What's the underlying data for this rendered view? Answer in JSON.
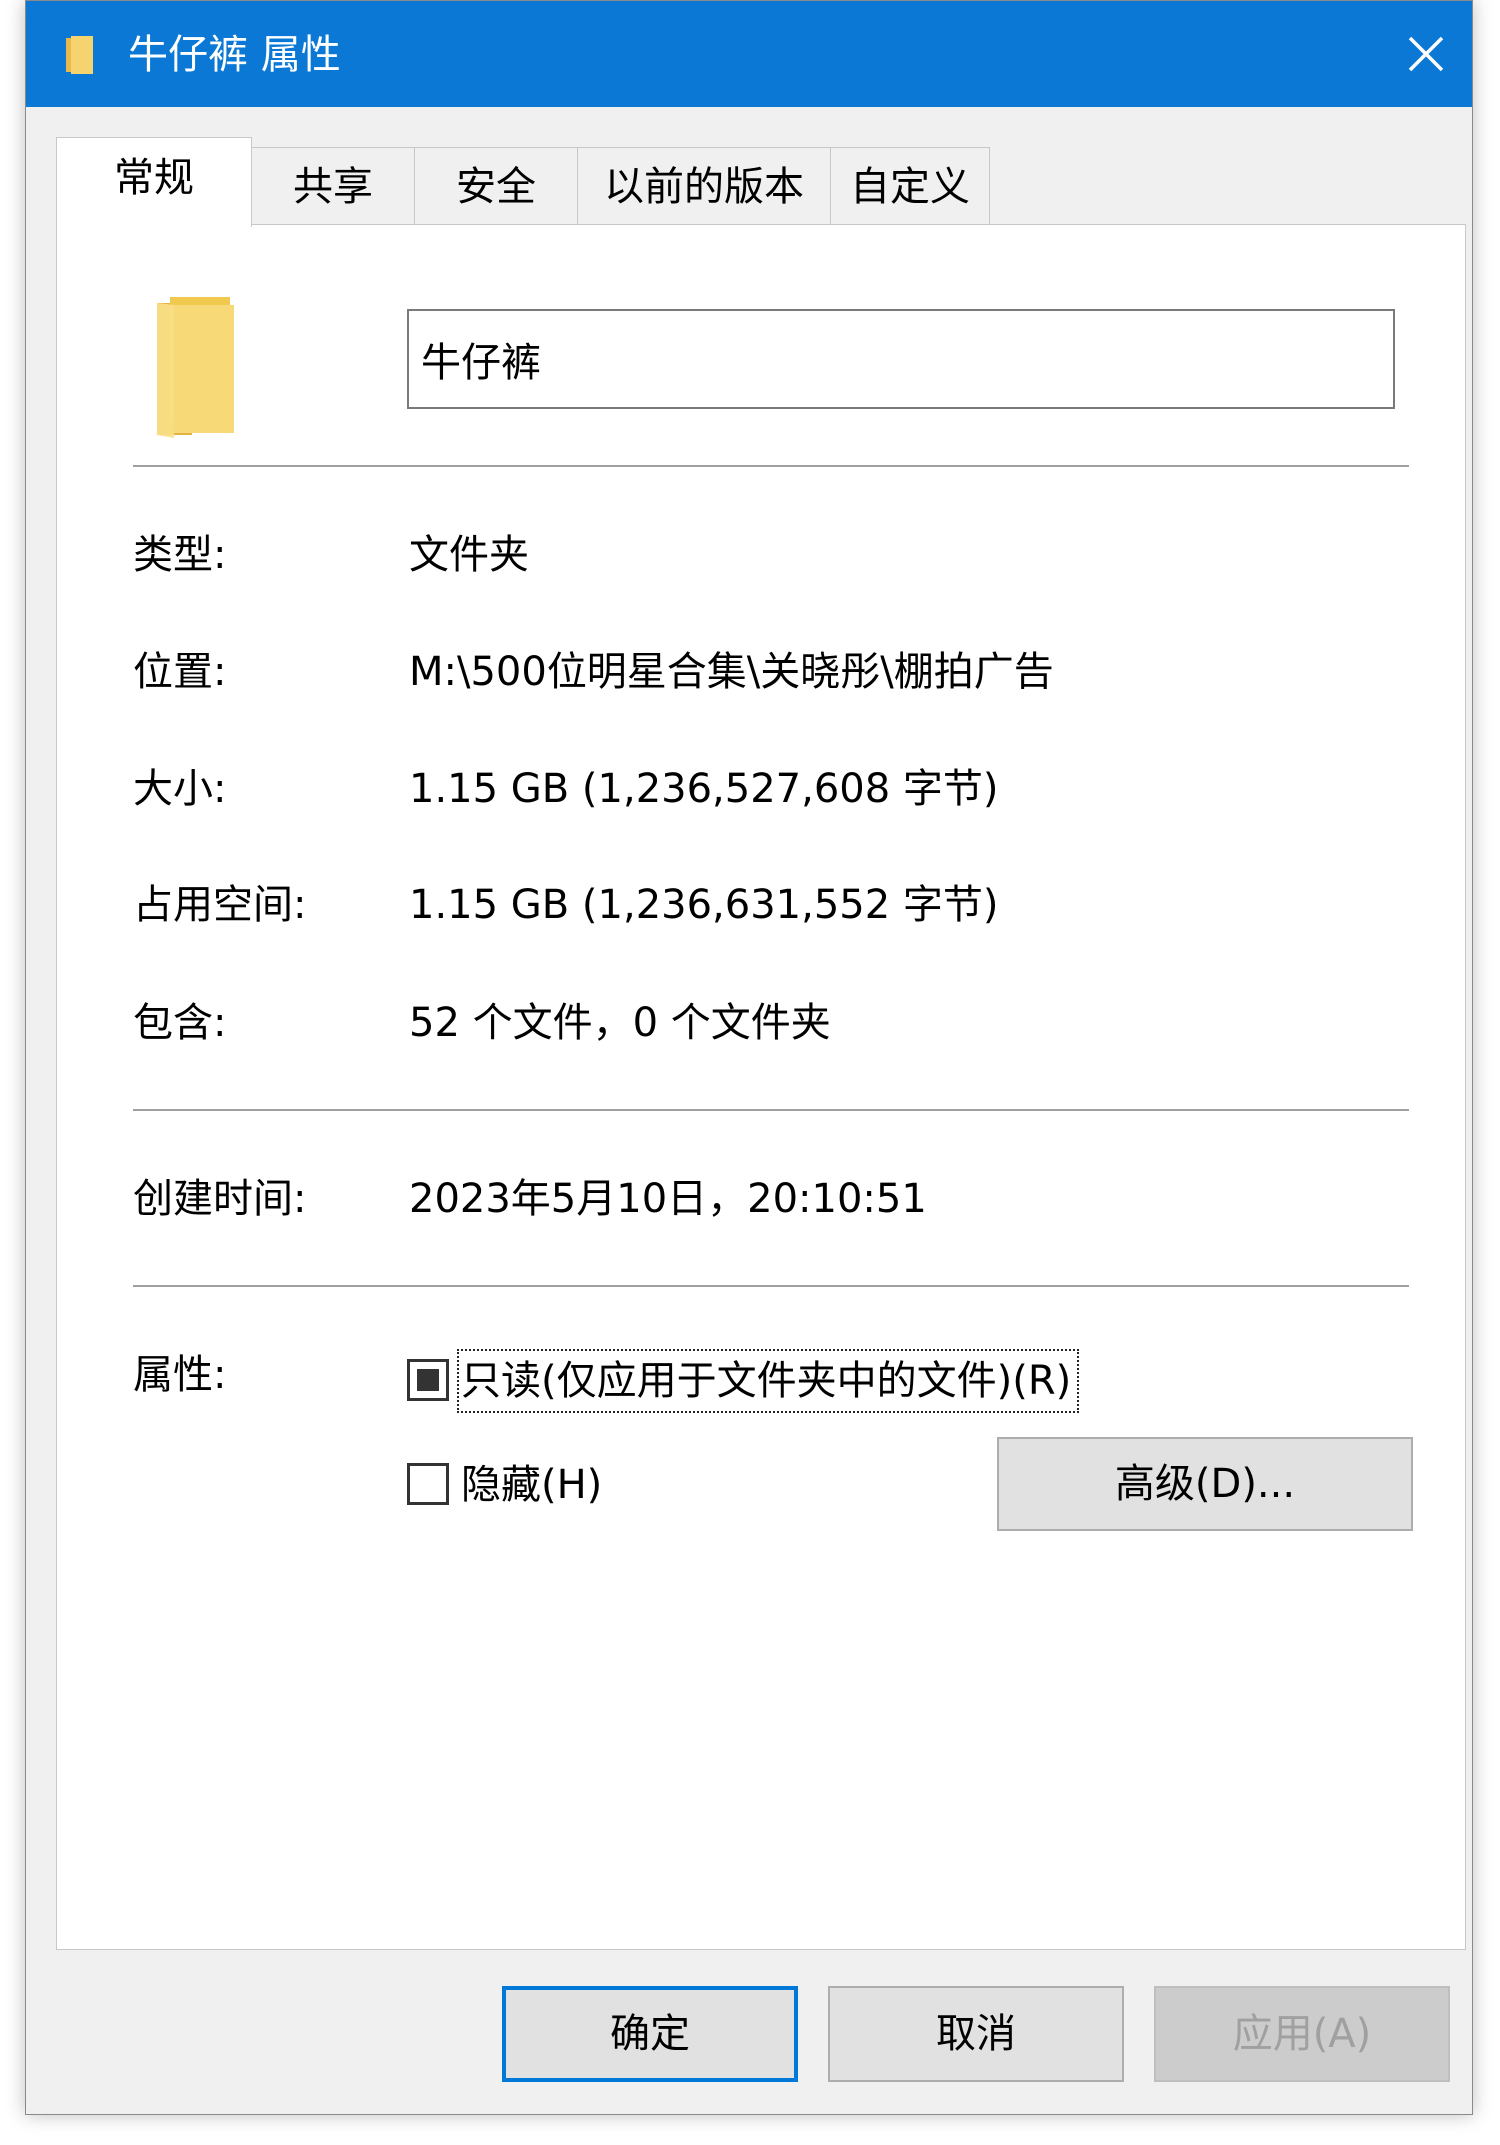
{
  "window": {
    "title": "牛仔裤 属性"
  },
  "tabs": [
    {
      "label": "常规"
    },
    {
      "label": "共享"
    },
    {
      "label": "安全"
    },
    {
      "label": "以前的版本"
    },
    {
      "label": "自定义"
    }
  ],
  "general": {
    "folder_name": "牛仔裤",
    "type_label": "类型:",
    "type_value": "文件夹",
    "location_label": "位置:",
    "location_value": "M:\\500位明星合集\\关晓彤\\棚拍广告",
    "size_label": "大小:",
    "size_value": "1.15 GB (1,236,527,608 字节)",
    "disk_label": "占用空间:",
    "disk_value": "1.15 GB (1,236,631,552 字节)",
    "contains_label": "包含:",
    "contains_value": "52 个文件，0 个文件夹",
    "created_label": "创建时间:",
    "created_value": "2023年5月10日，20:10:51",
    "attributes_label": "属性:",
    "readonly_label": "只读(仅应用于文件夹中的文件)(R)",
    "readonly_state": "indeterminate",
    "hidden_label": "隐藏(H)",
    "hidden_state": "unchecked",
    "advanced_label": "高级(D)..."
  },
  "buttons": {
    "ok": "确定",
    "cancel": "取消",
    "apply": "应用(A)"
  },
  "colors": {
    "titlebar": "#0a78d4",
    "folder": "#f5d470",
    "default_button_border": "#0078d7"
  }
}
